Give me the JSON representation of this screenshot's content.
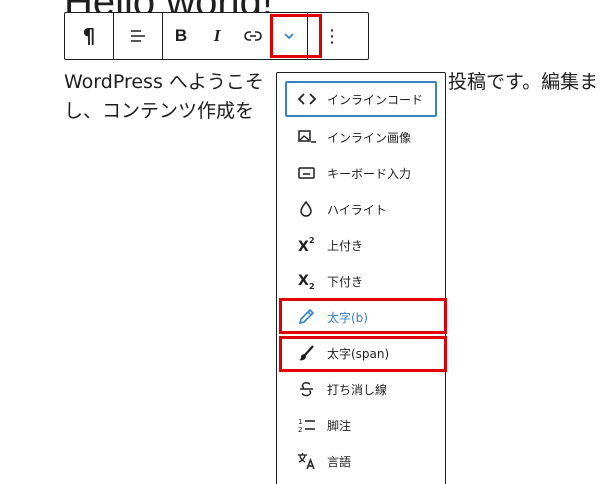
{
  "post": {
    "title": "Hello world!",
    "body_line1_left": "WordPress へようこそ",
    "body_line1_right": "投稿です。編集ま",
    "body_line2": "し、コンテンツ作成を"
  },
  "toolbar": {
    "paragraph_glyph": "¶",
    "bold_label": "B",
    "italic_label": "I",
    "more_glyph": "⋮"
  },
  "format_menu": {
    "items": [
      {
        "label": "インラインコード",
        "icon": "code-icon"
      },
      {
        "label": "インライン画像",
        "icon": "image-icon"
      },
      {
        "label": "キーボード入力",
        "icon": "keyboard-icon"
      },
      {
        "label": "ハイライト",
        "icon": "drop-icon"
      },
      {
        "label": "上付き",
        "icon": "superscript-icon"
      },
      {
        "label": "下付き",
        "icon": "subscript-icon"
      },
      {
        "label": "太字(b)",
        "icon": "pencil-icon"
      },
      {
        "label": "太字(span)",
        "icon": "brush-icon"
      },
      {
        "label": "打ち消し線",
        "icon": "strikethrough-icon"
      },
      {
        "label": "脚注",
        "icon": "footnote-icon"
      },
      {
        "label": "言語",
        "icon": "language-icon"
      }
    ]
  },
  "colors": {
    "accent": "#3582c4",
    "highlight_border": "#e00000",
    "text": "#1e1e1e"
  }
}
